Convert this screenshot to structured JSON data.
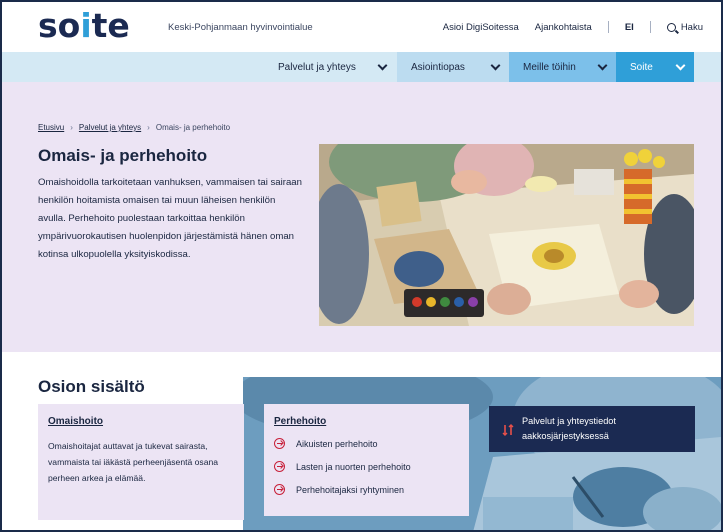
{
  "header": {
    "logo_main": "so",
    "logo_accent": "i",
    "logo_end": "te",
    "tagline": "Keski-Pohjanmaan hyvinvointialue",
    "links": [
      "Asioi DigiSoitessa",
      "Ajankohtaista"
    ],
    "language": "EI",
    "search_label": "Haku"
  },
  "nav": {
    "items": [
      "Palvelut ja yhteys",
      "Asiointiopas",
      "Meille töihin",
      "Soite"
    ]
  },
  "breadcrumb": {
    "home": "Etusivu",
    "parent": "Palvelut ja yhteys",
    "current": "Omais- ja perhehoito",
    "separator": "›"
  },
  "hero": {
    "title": "Omais- ja perhehoito",
    "intro": "Omaishoidolla tarkoitetaan vanhuksen, vammaisen tai sairaan henkilön hoitamista omaisen tai muun läheisen henkilön avulla. Perhehoito puolestaan tarkoittaa henkilön ympärivuorokautisen huolenpidon järjestämistä hänen oman kotinsa ulkopuolella yksityiskodissa."
  },
  "section": {
    "title": "Osion sisältö",
    "card_omaishoito": {
      "title": "Omaishoito",
      "text": "Omaishoitajat auttavat ja tukevat sairasta, vammaista tai iäkästä perheenjäsentä osana perheen arkea ja elämää."
    },
    "card_perhehoito": {
      "title": "Perhehoito",
      "links": [
        "Aikuisten perhehoito",
        "Lasten ja nuorten perhehoito",
        "Perhehoitajaksi ryhtyminen"
      ]
    },
    "services_card": {
      "text": "Palvelut ja yhteystiedot aakkosjärjestyksessä"
    }
  },
  "colors": {
    "navy": "#1b2a52",
    "accent_blue": "#2f9fd8",
    "lavender": "#ece4f4",
    "arrow_red": "#c8203a"
  }
}
